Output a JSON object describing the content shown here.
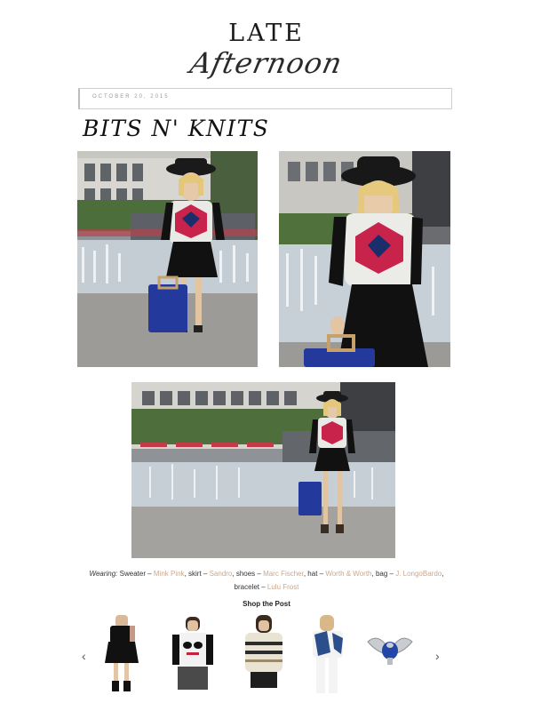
{
  "blog": {
    "logo_top": "LATE",
    "logo_script": "Afternoon",
    "date": "OCTOBER 20, 2015"
  },
  "post": {
    "title": "BITS N' KNITS"
  },
  "credits": {
    "wearing_label": "Wearing:",
    "line1": [
      {
        "text": " Sweater – ",
        "link": false
      },
      {
        "text": "Mink Pink",
        "link": true
      },
      {
        "text": ", skirt – ",
        "link": false
      },
      {
        "text": "Sandro",
        "link": true
      },
      {
        "text": ", shoes – ",
        "link": false
      },
      {
        "text": "Marc Fischer",
        "link": true
      },
      {
        "text": ", hat – ",
        "link": false
      },
      {
        "text": "Worth & Worth",
        "link": true
      },
      {
        "text": ", bag – ",
        "link": false
      },
      {
        "text": "J. LongoBardo",
        "link": true
      },
      {
        "text": ",",
        "link": false
      }
    ],
    "line2": [
      {
        "text": "bracelet – ",
        "link": false
      },
      {
        "text": "Lulu Frost",
        "link": true
      }
    ]
  },
  "shop": {
    "title": "Shop the Post",
    "prev_icon": "‹",
    "next_icon": "›",
    "products": [
      {
        "icon": "black-skirt-outfit"
      },
      {
        "icon": "graphic-sunglasses-sweater"
      },
      {
        "icon": "striped-knit-sweater"
      },
      {
        "icon": "striped-top-jeans"
      },
      {
        "icon": "winged-scarab-bracelet"
      }
    ]
  },
  "colors": {
    "link": "#c9a890",
    "text": "#222222",
    "border": "#cfcfcf"
  }
}
